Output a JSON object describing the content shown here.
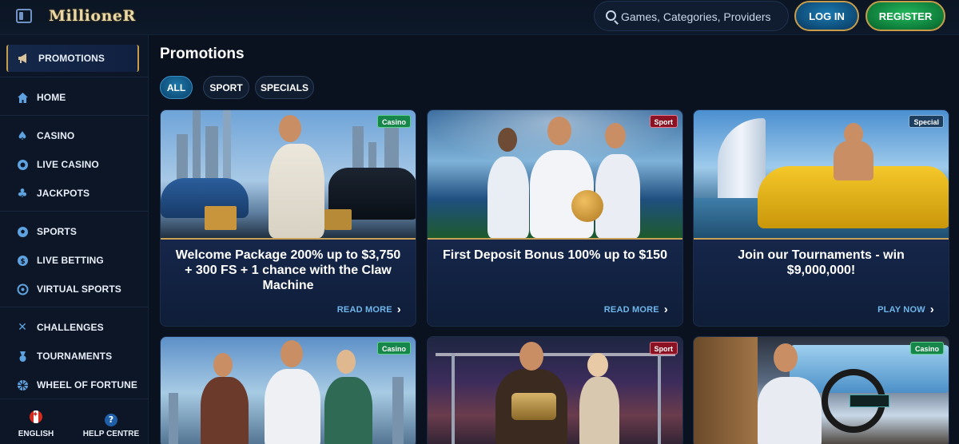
{
  "header": {
    "logo": "MillioneR",
    "search_placeholder": "Games, Categories, Providers",
    "login_label": "LOG IN",
    "register_label": "REGISTER"
  },
  "sidebar": {
    "items": [
      {
        "label": "PROMOTIONS",
        "icon": "megaphone-icon"
      },
      {
        "label": "HOME",
        "icon": "home-icon"
      },
      {
        "label": "CASINO",
        "icon": "spade-icon"
      },
      {
        "label": "LIVE CASINO",
        "icon": "chip-icon"
      },
      {
        "label": "JACKPOTS",
        "icon": "clover-icon"
      },
      {
        "label": "SPORTS",
        "icon": "soccer-ball-icon"
      },
      {
        "label": "LIVE BETTING",
        "icon": "coin-icon"
      },
      {
        "label": "VIRTUAL SPORTS",
        "icon": "virtual-ball-icon"
      },
      {
        "label": "CHALLENGES",
        "icon": "crossed-swords-icon"
      },
      {
        "label": "TOURNAMENTS",
        "icon": "medal-icon"
      },
      {
        "label": "WHEEL OF FORTUNE",
        "icon": "wheel-icon"
      }
    ],
    "footer": {
      "language": "ENGLISH",
      "help": "HELP CENTRE"
    }
  },
  "main": {
    "title": "Promotions",
    "filters": [
      "ALL",
      "SPORT",
      "SPECIALS"
    ],
    "cards": [
      {
        "tag": "Casino",
        "title": "Welcome Package 200% up to $3,750 + 300 FS + 1 chance with the Claw Machine",
        "cta": "READ MORE"
      },
      {
        "tag": "Sport",
        "title": "First Deposit Bonus 100% up to $150",
        "cta": "READ MORE"
      },
      {
        "tag": "Special",
        "title": "Join our Tournaments - win $9,000,000!",
        "cta": "PLAY NOW"
      },
      {
        "tag": "Casino"
      },
      {
        "tag": "Sport"
      },
      {
        "tag": "Casino"
      }
    ]
  }
}
